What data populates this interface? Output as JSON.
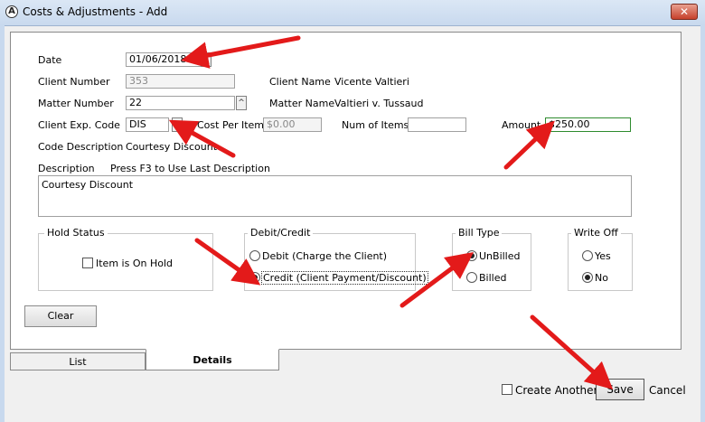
{
  "window": {
    "title": "Costs & Adjustments - Add",
    "close_label": "✕"
  },
  "form": {
    "date_label": "Date",
    "date_value": "01/06/2018",
    "client_number_label": "Client Number",
    "client_number_value": "353",
    "client_name_label": "Client Name",
    "client_name_value": "Vicente Valtieri",
    "matter_number_label": "Matter Number",
    "matter_number_value": "22",
    "matter_name_label": "Matter Name",
    "matter_name_value": "Valtieri v. Tussaud",
    "client_exp_code_label": "Client Exp. Code",
    "client_exp_code_value": "DIS",
    "cost_per_item_label": "Cost Per Item",
    "cost_per_item_placeholder": "$0.00",
    "num_items_label": "Num of Items",
    "num_items_value": "",
    "amount_label": "Amount",
    "amount_value": "$250.00",
    "code_description_label": "Code Description",
    "code_description_value": "Courtesy Discount",
    "description_label": "Description",
    "description_hint": "Press F3 to Use Last Description",
    "description_value": "Courtesy Discount"
  },
  "hold_status": {
    "title": "Hold Status",
    "checkbox_label": "Item is On Hold",
    "checked": false
  },
  "debit_credit": {
    "title": "Debit/Credit",
    "debit_label": "Debit (Charge the Client)",
    "credit_label": "Credit (Client Payment/Discount)",
    "selected": "credit"
  },
  "bill_type": {
    "title": "Bill Type",
    "unbilled_label": "UnBilled",
    "billed_label": "Billed",
    "selected": "unbilled"
  },
  "write_off": {
    "title": "Write Off",
    "yes_label": "Yes",
    "no_label": "No",
    "selected": "no"
  },
  "buttons": {
    "clear_label": "Clear",
    "save_label": "Save",
    "cancel_label": "Cancel",
    "create_another_label": "Create Another"
  },
  "tabs": [
    {
      "label": "List",
      "active": false
    },
    {
      "label": "Details",
      "active": true
    }
  ],
  "colors": {
    "annotation_arrow": "#e31a1a",
    "amount_border": "#2e8b2e",
    "title_bar": "#c8d9ee"
  }
}
